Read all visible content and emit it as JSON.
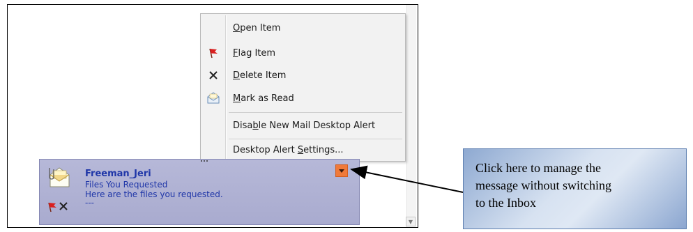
{
  "menu": {
    "items": [
      {
        "pre": "",
        "key": "O",
        "post": "pen Item"
      },
      {
        "pre": "",
        "key": "F",
        "post": "lag Item"
      },
      {
        "pre": "",
        "key": "D",
        "post": "elete Item"
      },
      {
        "pre": "",
        "key": "M",
        "post": "ark as Read"
      },
      {
        "pre": "Disa",
        "key": "b",
        "post": "le New Mail Desktop Alert"
      },
      {
        "pre": "Desktop Alert ",
        "key": "S",
        "post": "ettings..."
      }
    ],
    "icons": [
      "none",
      "red-flag-icon",
      "delete-x-icon",
      "envelope-open-icon",
      "none",
      "none"
    ]
  },
  "alert": {
    "sender": "Freeman_Jeri",
    "subject": "Files You Requested",
    "preview": "Here are the files you requested.",
    "trailer": "---",
    "options_button_color": "#f07a3a"
  },
  "callout": {
    "lines": [
      "Click here to manage the",
      "message without switching",
      "to the Inbox"
    ]
  },
  "colors": {
    "alert_text": "#1f36a8",
    "alert_background": "#b6b8d8",
    "callout_border": "#5e7fb0"
  }
}
